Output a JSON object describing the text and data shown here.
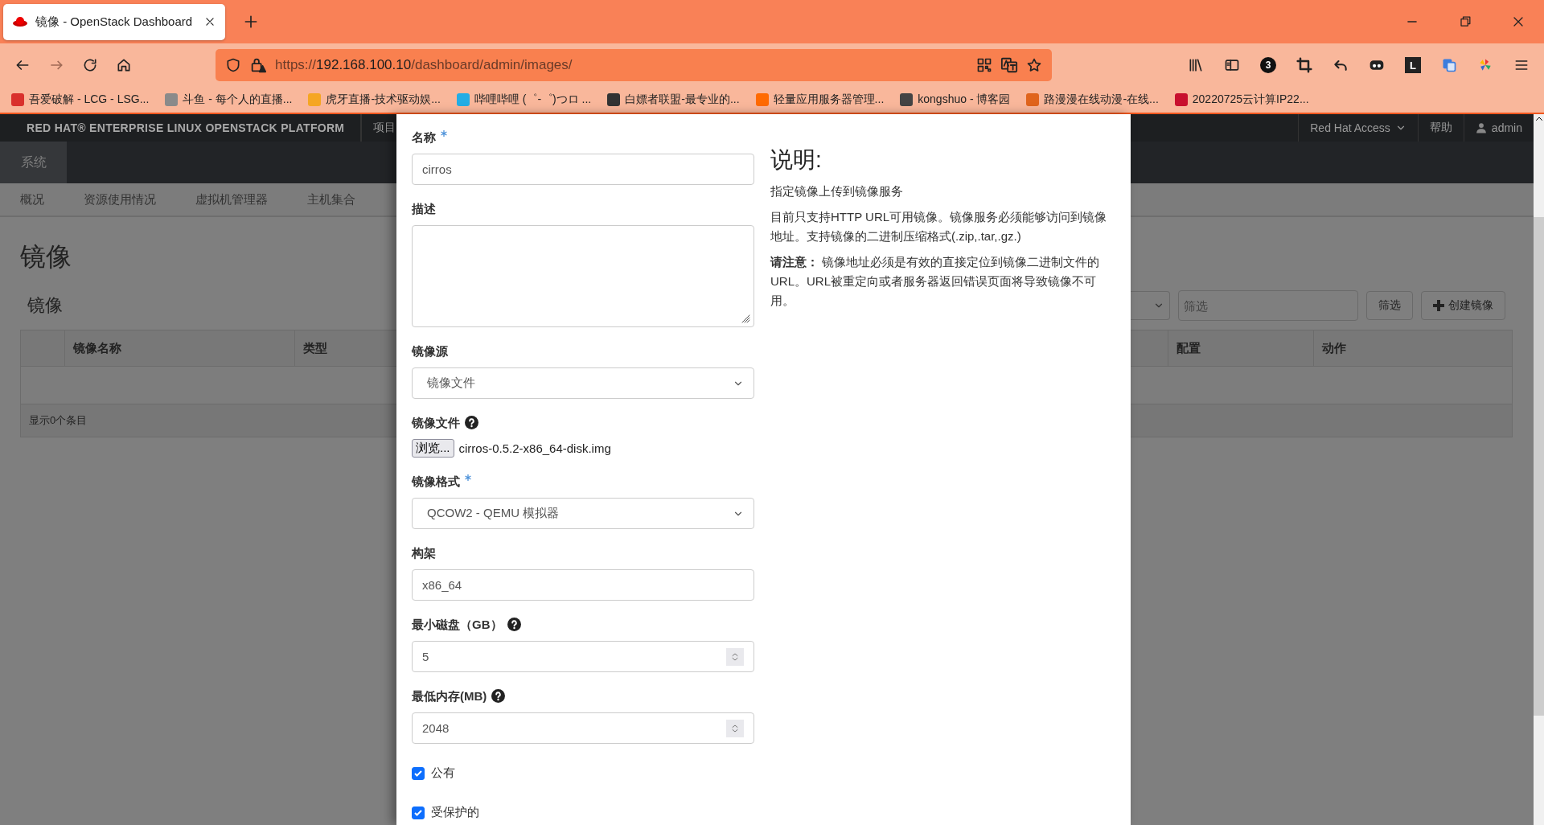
{
  "browser": {
    "tab": {
      "title": "镜像 - OpenStack Dashboard",
      "selected": true
    },
    "url": {
      "scheme": "https://",
      "host": "192.168.100.10",
      "path": "/dashboard/admin/images/"
    },
    "toolbar_badge": "3",
    "extension_label": "L",
    "bookmarks": [
      {
        "label": "吾爱破解 - LCG - LSG...",
        "color": "#d9302c"
      },
      {
        "label": "斗鱼 - 每个人的直播...",
        "color": "#8a8a8a"
      },
      {
        "label": "虎牙直播-技术驱动娱...",
        "color": "#f5a623"
      },
      {
        "label": "哔哩哔哩 (゜-゜)つロ ...",
        "color": "#23ade5"
      },
      {
        "label": "白嫖者联盟-最专业的...",
        "color": "#333333"
      },
      {
        "label": "轻量应用服务器管理...",
        "color": "#ff6a00"
      },
      {
        "label": "kongshuo - 博客园",
        "color": "#444444"
      },
      {
        "label": "路漫漫在线动漫-在线...",
        "color": "#e0641c"
      },
      {
        "label": "20220725云计算IP22...",
        "color": "#c8102e"
      }
    ]
  },
  "dashboard": {
    "brand": "RED HAT® ENTERPRISE LINUX OPENSTACK PLATFORM",
    "top_menu": [
      "项目"
    ],
    "user_menu": [
      {
        "label": "Red Hat Access",
        "kind": "dropdown"
      },
      {
        "label": "帮助",
        "kind": "link"
      },
      {
        "label": "admin",
        "kind": "user"
      }
    ],
    "nav_tabs": [
      {
        "label": "系统",
        "selected": true
      }
    ],
    "subnav": [
      "概况",
      "资源使用情况",
      "虚拟机管理器",
      "主机集合"
    ],
    "page_title": "镜像",
    "section_title": "镜像",
    "filter": {
      "placeholder": "筛选"
    },
    "buttons": [
      {
        "label": "筛选",
        "kind": "plain"
      },
      {
        "label": "创建镜像",
        "kind": "create"
      }
    ],
    "table": {
      "columns": [
        "镜像名称",
        "类型",
        "配置",
        "动作"
      ],
      "footer": "显示0个条目"
    }
  },
  "modal": {
    "fields": [
      {
        "kind": "text",
        "label": "名称",
        "required": true,
        "help": false,
        "value": "cirros"
      },
      {
        "kind": "textarea",
        "label": "描述",
        "required": false,
        "help": false
      },
      {
        "kind": "select",
        "label": "镜像源",
        "required": false,
        "help": false,
        "value": "镜像文件"
      },
      {
        "kind": "file",
        "label": "镜像文件",
        "required": false,
        "help": true,
        "button": "浏览...",
        "value": "cirros-0.5.2-x86_64-disk.img"
      },
      {
        "kind": "select",
        "label": "镜像格式",
        "required": true,
        "help": false,
        "value": "QCOW2 - QEMU 模拟器"
      },
      {
        "kind": "text",
        "label": "构架",
        "required": false,
        "help": false,
        "value": "x86_64"
      },
      {
        "kind": "number",
        "label": "最小磁盘（GB）",
        "required": false,
        "help": true,
        "value": "5"
      },
      {
        "kind": "number",
        "label": "最低内存(MB)",
        "required": false,
        "help": true,
        "value": "2048"
      },
      {
        "kind": "checkbox",
        "label": "公有",
        "checked": true
      },
      {
        "kind": "checkbox",
        "label": "受保护的",
        "checked": true
      }
    ],
    "help": {
      "title": "说明:",
      "paragraphs": [
        "指定镜像上传到镜像服务",
        "目前只支持HTTP URL可用镜像。镜像服务必须能够访问到镜像地址。支持镜像的二进制压缩格式(.zip,.tar,.gz.)",
        "**请注意：** 镜像地址必须是有效的直接定位到镜像二进制文件的URL。URL被重定向或者服务器返回错误页面将导致镜像不可用。"
      ]
    }
  }
}
